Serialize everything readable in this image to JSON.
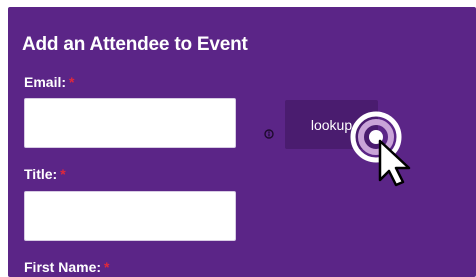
{
  "form": {
    "title": "Add an Attendee to Event",
    "required_marker": "*",
    "email": {
      "label": "Email:",
      "value": "",
      "placeholder": ""
    },
    "title_field": {
      "label": "Title:",
      "value": "",
      "placeholder": ""
    },
    "first_name": {
      "label": "First Name:"
    },
    "lookup_label": "lookup"
  },
  "icons": {
    "info": "info-circle-icon",
    "cursor": "mouse-pointer-icon",
    "click": "click-ripple-icon"
  },
  "colors": {
    "panel_bg": "#5b2587",
    "button_bg": "#4a1c6f",
    "required": "#e0283a",
    "text": "#ffffff"
  }
}
